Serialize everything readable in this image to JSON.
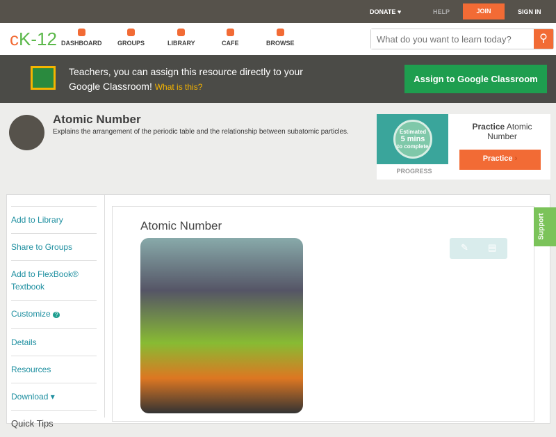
{
  "topbar": {
    "donate": "DONATE ♥",
    "help": "HELP",
    "join": "JOIN",
    "signin": "SIGN IN"
  },
  "nav": {
    "logo": "cK-12",
    "items": [
      "DASHBOARD",
      "GROUPS",
      "LIBRARY",
      "CAFE",
      "BROWSE"
    ],
    "search_placeholder": "What do you want to learn today?"
  },
  "banner": {
    "text": "Teachers, you can assign this resource directly to your Google Classroom!",
    "link": "What is this?",
    "button": "Assign to Google Classroom"
  },
  "concept": {
    "title": "Atomic Number",
    "description": "Explains the arrangement of the periodic table and the relationship between subatomic particles."
  },
  "practice": {
    "estimate1": "Estimated",
    "estimate2": "5 mins",
    "estimate3": "to complete",
    "progress": "PROGRESS",
    "label_bold": "Practice",
    "label": "Atomic Number",
    "button": "Practice"
  },
  "sidebar": {
    "items": [
      "Add to Library",
      "Share to Groups",
      "Add to FlexBook® Textbook",
      "Customize",
      "Details",
      "Resources",
      "Download ▾",
      "Quick Tips"
    ]
  },
  "main": {
    "title": "Atomic Number"
  },
  "support": "Support"
}
